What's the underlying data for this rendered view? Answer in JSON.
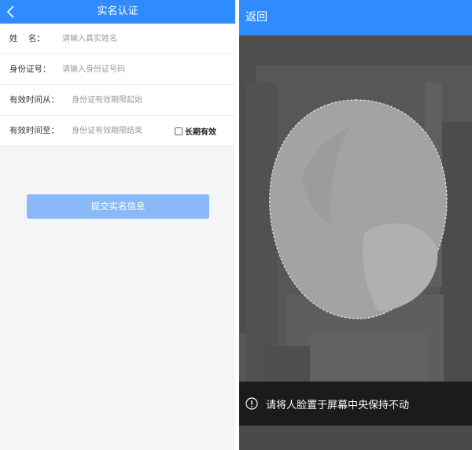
{
  "left": {
    "header": {
      "title": "实名认证",
      "back_icon": "chevron-left-icon"
    },
    "form": {
      "rows": [
        {
          "label": "姓    名：",
          "placeholder": "请输入真实姓名"
        },
        {
          "label": "身份证号：",
          "placeholder": "请输入身份证号码"
        },
        {
          "label": "有效时间从：",
          "placeholder": "身份证有效期限起始"
        },
        {
          "label": "有效时间至：",
          "placeholder": "身份证有效期限结束"
        }
      ],
      "longterm": {
        "label": "长期有效",
        "checked": false
      }
    },
    "submit_label": "提交实名信息",
    "colors": {
      "header": "#2f8cff",
      "submit": "#8ab9f8",
      "background": "#f4f5f7"
    }
  },
  "right": {
    "header": {
      "back_label": "返回"
    },
    "hint": {
      "icon": "info-circle-icon",
      "text": "请将人脸置于屏幕中央保持不动"
    },
    "colors": {
      "header": "#2f8cff",
      "camera": "#565656",
      "face": "#a3a3a3",
      "hint_bg": "#1b1b1b"
    }
  }
}
